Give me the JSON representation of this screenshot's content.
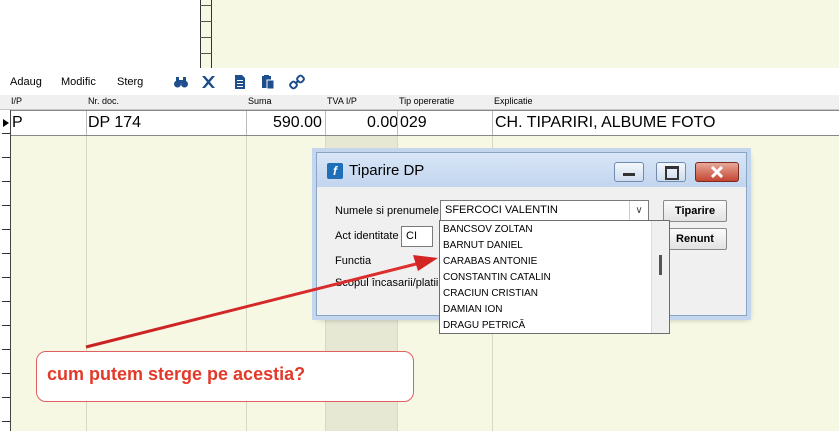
{
  "toolbar": {
    "add_label": "Adaug",
    "edit_label": "Modific",
    "delete_label": "Sterg"
  },
  "grid": {
    "columns": [
      "I/P",
      "Nr. doc.",
      "Suma",
      "TVA I/P",
      "Tip opereratie",
      "Explicatie"
    ],
    "row": {
      "ip": "P",
      "nr_doc": "DP 174",
      "suma": "590.00",
      "tva": "0.00",
      "tip": "029",
      "explicatie": "CH. TIPARIRI, ALBUME FOTO"
    }
  },
  "dialog": {
    "title": "Tiparire DP",
    "name_label": "Numele si prenumele",
    "name_value": "SFERCOCI VALENTIN",
    "act_label": "Act identitate",
    "act_value": "CI",
    "functia_label": "Functia",
    "scop_label": "Scopul încasarii/platii",
    "print_button": "Tiparire",
    "cancel_button": "Renunt"
  },
  "dropdown": {
    "items": [
      "BANCSOV ZOLTAN",
      "BARNUT DANIEL",
      "CARABAS ANTONIE",
      "CONSTANTIN CATALIN",
      "CRACIUN CRISTIAN",
      "DAMIAN ION",
      "DRAGU PETRICĂ"
    ]
  },
  "annotation": {
    "text": "cum putem sterge pe acestia?",
    "color": "#e23a2a"
  }
}
